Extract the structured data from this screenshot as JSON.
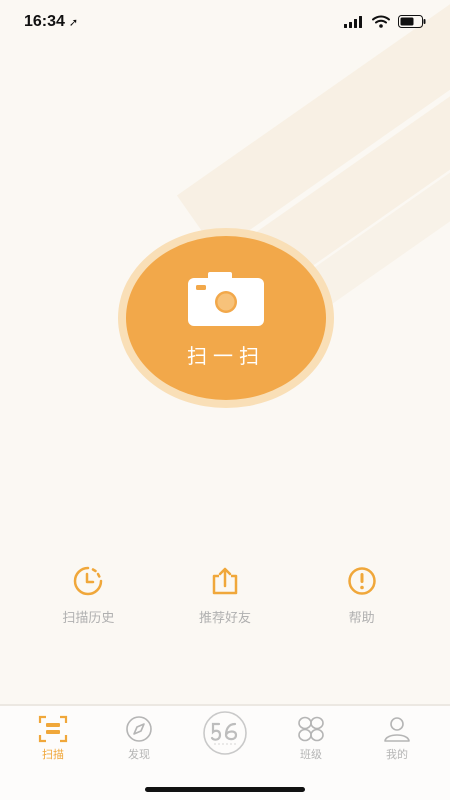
{
  "status_bar": {
    "time": "16:34",
    "location_glyph": "➚"
  },
  "scan": {
    "label": "扫一扫",
    "icon": "camera-icon"
  },
  "quick_actions": [
    {
      "label": "扫描历史",
      "icon": "history-icon"
    },
    {
      "label": "推荐好友",
      "icon": "share-icon"
    },
    {
      "label": "帮助",
      "icon": "help-icon"
    }
  ],
  "tabs": [
    {
      "label": "扫描",
      "icon": "scan-icon",
      "active": true
    },
    {
      "label": "发现",
      "icon": "compass-icon",
      "active": false
    },
    {
      "label": "",
      "icon": "logo-56-icon",
      "active": false
    },
    {
      "label": "班级",
      "icon": "class-icon",
      "active": false
    },
    {
      "label": "我的",
      "icon": "user-icon",
      "active": false
    }
  ],
  "colors": {
    "accent": "#f2a84a",
    "halo": "#f9dfb7",
    "muted": "#b0b0b0",
    "background": "#fbf8f3"
  }
}
